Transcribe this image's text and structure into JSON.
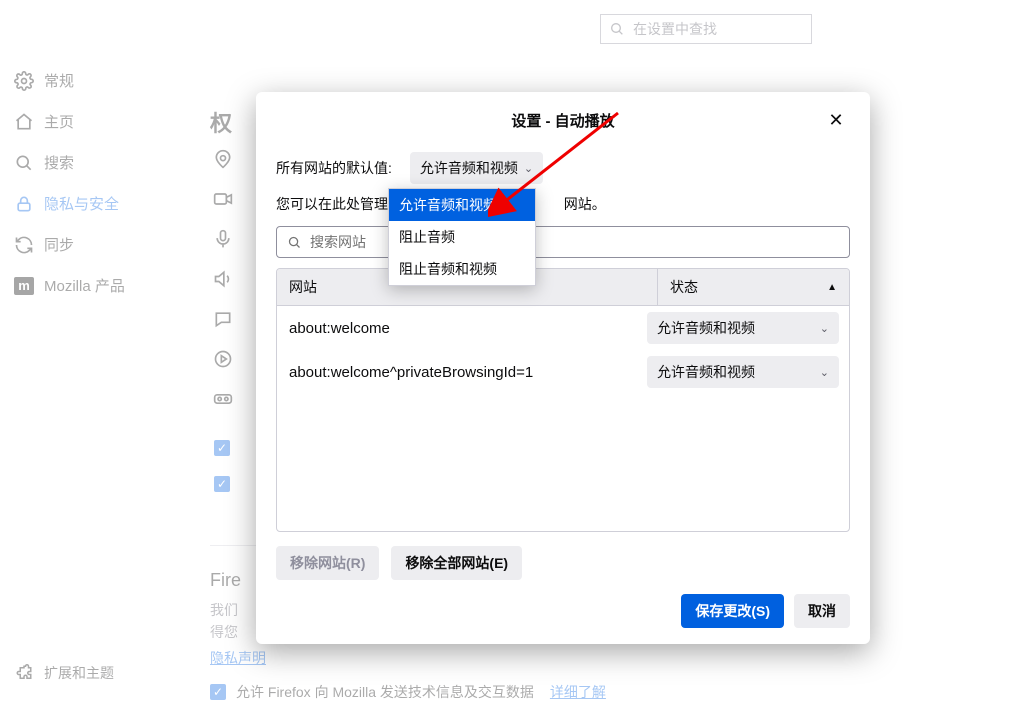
{
  "search_settings_placeholder": "在设置中查找",
  "sidebar": {
    "items": [
      {
        "label": "常规"
      },
      {
        "label": "主页"
      },
      {
        "label": "搜索"
      },
      {
        "label": "隐私与安全"
      },
      {
        "label": "同步"
      },
      {
        "label": "Mozilla 产品"
      }
    ],
    "bottom": "扩展和主题"
  },
  "section_title_partial": "权",
  "truncated_fire": "Fire",
  "truncated_we": "我们",
  "truncated_de": "得您",
  "privacy_statement": "隐私声明",
  "bottom_checkbox_label": "允许 Firefox 向 Mozilla 发送技术信息及交互数据",
  "learn_more": "详细了解",
  "dialog": {
    "title": "设置 - 自动播放",
    "default_label": "所有网站的默认值:",
    "default_value": "允许音频和视频",
    "desc_prefix": "您可以在此处管理不遵",
    "desc_suffix": "网站。",
    "search_placeholder": "搜索网站",
    "col_site": "网站",
    "col_status": "状态",
    "rows": [
      {
        "site": "about:welcome",
        "status": "允许音频和视频"
      },
      {
        "site": "about:welcome^privateBrowsingId=1",
        "status": "允许音频和视频"
      }
    ],
    "remove_site": "移除网站(R)",
    "remove_all": "移除全部网站(E)",
    "save": "保存更改(S)",
    "cancel": "取消"
  },
  "dropdown_options": [
    "允许音频和视频",
    "阻止音频",
    "阻止音频和视频"
  ]
}
